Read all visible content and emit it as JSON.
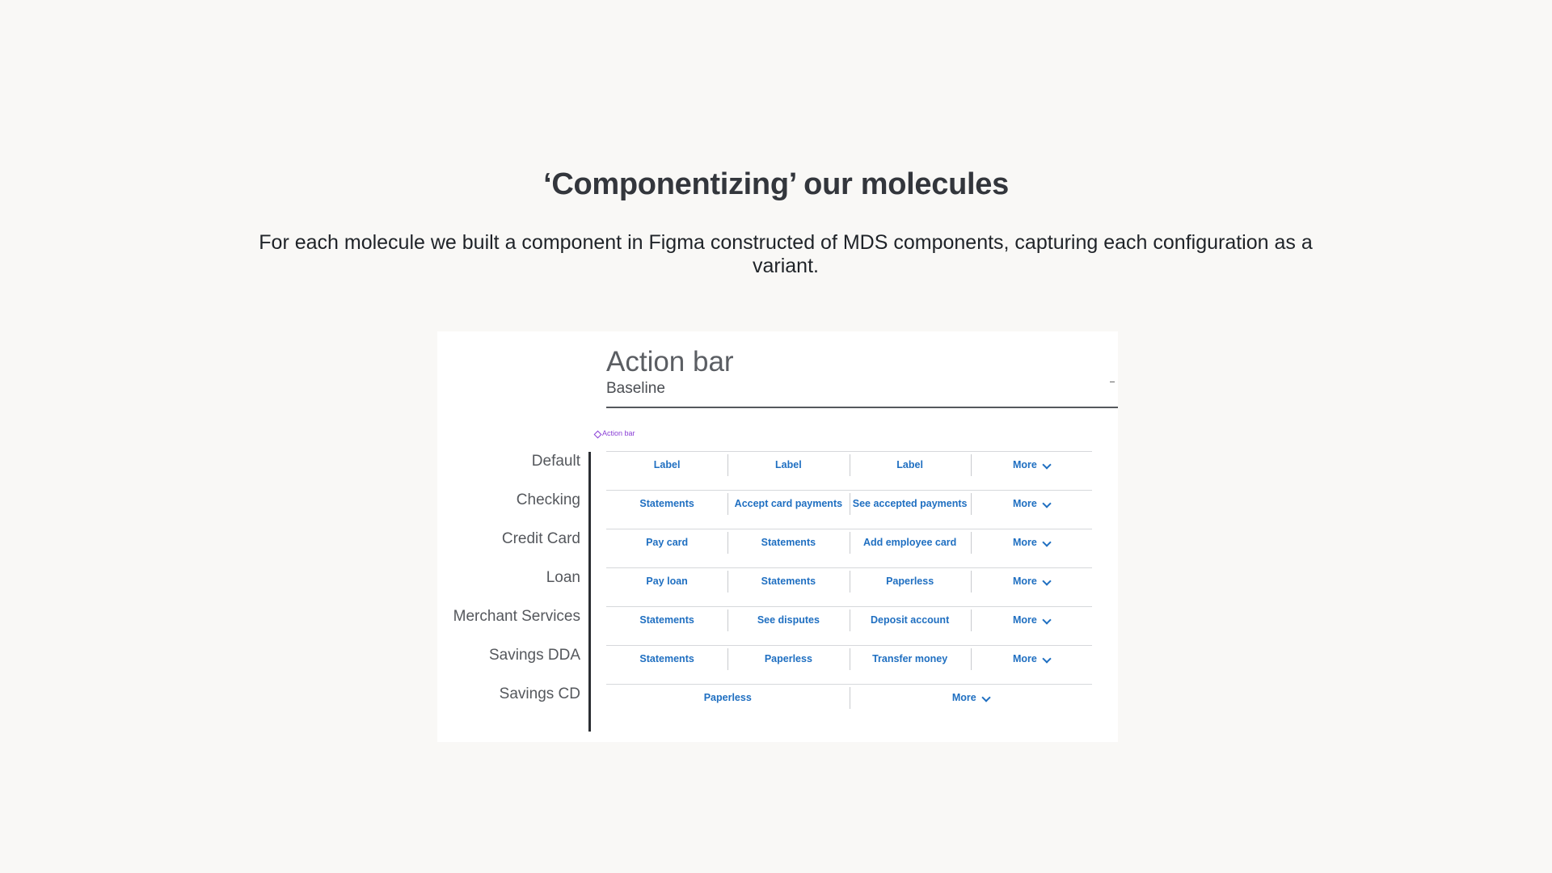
{
  "heading": "‘Componentizing’ our molecules",
  "description": "For each molecule we built a component in Figma constructed of MDS components, capturing each configuration as a variant.",
  "card": {
    "title": "Action bar",
    "subtitle": "Baseline",
    "component_tag": "Action bar",
    "colors": {
      "action_text": "#1f6fc1",
      "component_tag": "#8a3fd6"
    },
    "rows": [
      {
        "label": "Default",
        "actions": [
          "Label",
          "Label",
          "Label"
        ],
        "more": "More"
      },
      {
        "label": "Checking",
        "actions": [
          "Statements",
          "Accept card payments",
          "See accepted payments"
        ],
        "more": "More"
      },
      {
        "label": "Credit Card",
        "actions": [
          "Pay card",
          "Statements",
          "Add employee card"
        ],
        "more": "More"
      },
      {
        "label": "Loan",
        "actions": [
          "Pay loan",
          "Statements",
          "Paperless"
        ],
        "more": "More"
      },
      {
        "label": "Merchant Services",
        "actions": [
          "Statements",
          "See disputes",
          "Deposit account"
        ],
        "more": "More"
      },
      {
        "label": "Savings DDA",
        "actions": [
          "Statements",
          "Paperless",
          "Transfer money"
        ],
        "more": "More"
      },
      {
        "label": "Savings CD",
        "actions": [
          "Paperless"
        ],
        "more": "More"
      }
    ]
  }
}
